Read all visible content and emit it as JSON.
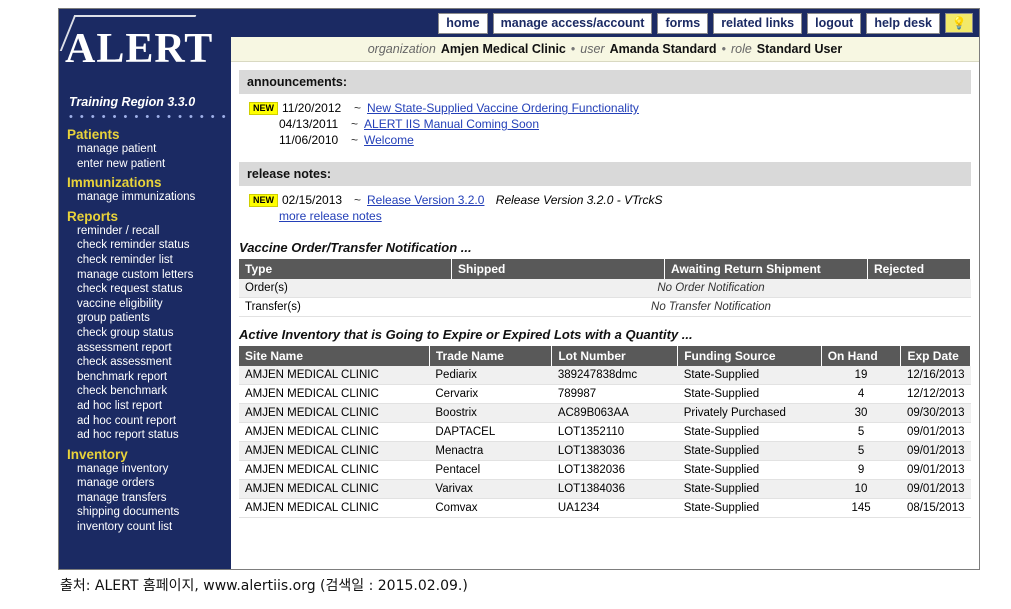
{
  "topnav": {
    "items": [
      "home",
      "manage access/account",
      "forms",
      "related links",
      "logout",
      "help desk"
    ],
    "bulb_icon": "lightbulb-icon"
  },
  "orgbar": {
    "org_label": "organization",
    "org_value": "Amjen Medical Clinic",
    "user_label": "user",
    "user_value": "Amanda Standard",
    "role_label": "role",
    "role_value": "Standard User",
    "sep": "•"
  },
  "sidebar": {
    "logo": "ALERT",
    "region": "Training Region 3.3.0",
    "dots": "• • • • • • • • • • • • • • • • •",
    "groups": [
      {
        "heading": "Patients",
        "items": [
          "manage patient",
          "enter new patient"
        ]
      },
      {
        "heading": "Immunizations",
        "items": [
          "manage immunizations"
        ]
      },
      {
        "heading": "Reports",
        "items": [
          "reminder / recall",
          "check reminder status",
          "check reminder list",
          "manage custom letters",
          "check request status",
          "vaccine eligibility",
          "group patients",
          "check group status",
          "assessment report",
          "check assessment",
          "benchmark report",
          "check benchmark",
          "ad hoc list report",
          "ad hoc count report",
          "ad hoc report status"
        ]
      },
      {
        "heading": "Inventory",
        "items": [
          "manage inventory",
          "manage orders",
          "manage transfers",
          "shipping documents",
          "inventory count list"
        ]
      }
    ]
  },
  "announcements": {
    "title": "announcements:",
    "new_badge": "NEW",
    "rows": [
      {
        "new": true,
        "date": "11/20/2012",
        "link": "New State-Supplied Vaccine Ordering Functionality"
      },
      {
        "new": false,
        "date": "04/13/2011",
        "link": "ALERT IIS Manual Coming Soon"
      },
      {
        "new": false,
        "date": "11/06/2010",
        "link": "Welcome"
      }
    ]
  },
  "release_notes": {
    "title": "release notes:",
    "new_badge": "NEW",
    "date": "02/15/2013",
    "link": "Release Version 3.2.0",
    "detail": "Release Version 3.2.0 - VTrckS",
    "more_link": "more release notes"
  },
  "order_transfer": {
    "title": "Vaccine Order/Transfer Notification ...",
    "columns": [
      "Type",
      "Shipped",
      "Awaiting Return Shipment",
      "Rejected"
    ],
    "rows": [
      {
        "type": "Order(s)",
        "note": "No Order Notification"
      },
      {
        "type": "Transfer(s)",
        "note": "No Transfer Notification"
      }
    ]
  },
  "inventory": {
    "title": "Active Inventory that is Going to Expire or Expired Lots with a Quantity ...",
    "columns": [
      "Site Name",
      "Trade Name",
      "Lot Number",
      "Funding Source",
      "On Hand",
      "Exp Date"
    ],
    "rows": [
      [
        "AMJEN MEDICAL CLINIC",
        "Pediarix",
        "389247838dmc",
        "State-Supplied",
        "19",
        "12/16/2013"
      ],
      [
        "AMJEN MEDICAL CLINIC",
        "Cervarix",
        "789987",
        "State-Supplied",
        "4",
        "12/12/2013"
      ],
      [
        "AMJEN MEDICAL CLINIC",
        "Boostrix",
        "AC89B063AA",
        "Privately Purchased",
        "30",
        "09/30/2013"
      ],
      [
        "AMJEN MEDICAL CLINIC",
        "DAPTACEL",
        "LOT1352110",
        "State-Supplied",
        "5",
        "09/01/2013"
      ],
      [
        "AMJEN MEDICAL CLINIC",
        "Menactra",
        "LOT1383036",
        "State-Supplied",
        "5",
        "09/01/2013"
      ],
      [
        "AMJEN MEDICAL CLINIC",
        "Pentacel",
        "LOT1382036",
        "State-Supplied",
        "9",
        "09/01/2013"
      ],
      [
        "AMJEN MEDICAL CLINIC",
        "Varivax",
        "LOT1384036",
        "State-Supplied",
        "10",
        "09/01/2013"
      ],
      [
        "AMJEN MEDICAL CLINIC",
        "Comvax",
        "UA1234",
        "State-Supplied",
        "145",
        "08/15/2013"
      ]
    ]
  },
  "caption": "출처: ALERT 홈페이지, www.alertiis.org (검색일 : 2015.02.09.)"
}
